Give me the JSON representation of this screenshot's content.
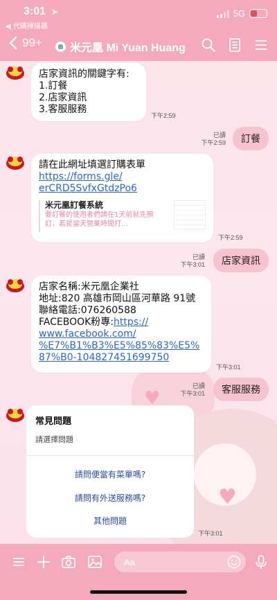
{
  "status": {
    "time": "3:01",
    "back_app": "◀ 代碼掃描器",
    "network": "5G"
  },
  "header": {
    "back_count": "99+",
    "title": "米元凰 Mi Yuan Huang"
  },
  "messages": {
    "m1": {
      "lines": [
        "店家資訊的關鍵字有:",
        "1.訂餐",
        "2.店家資訊",
        "3.客服服務"
      ],
      "time": "下午2:59"
    },
    "o1": {
      "text": "訂餐",
      "read": "已讀",
      "time": "下午2:59"
    },
    "m2": {
      "lead": "請在此網址填選訂購表單",
      "url1": "https://forms.gle/",
      "url2": "erCRD5SvfxGtdzPo6",
      "preview_title": "米元凰訂餐系統",
      "preview_desc": "要訂餐的使用者們請在1天前就先預訂，若是當天營業時間打...",
      "time": "下午2:59"
    },
    "o2": {
      "text": "店家資訊",
      "read": "已讀",
      "time": "下午3:01"
    },
    "m3": {
      "lines": [
        "店家名稱:米元凰企業社",
        "地址:820 高雄市岡山區河華路 91號",
        "聯絡電話:076260588"
      ],
      "fb_label": "FACEBOOK粉專:",
      "fb_url": [
        "https://",
        "www.facebook.com/",
        "%E7%B1%B3%E5%85%83%E5%",
        "87%B0-104827451699750"
      ],
      "time": "下午3:01"
    },
    "o3": {
      "text": "客服服務",
      "read": "已讀",
      "time": "下午3:01"
    },
    "faq": {
      "title": "常見問題",
      "subtitle": "請選擇問題",
      "options": [
        "請問便當有菜單嗎?",
        "請問有外送服務嗎?",
        "其他問題"
      ],
      "time": "下午3:01"
    }
  },
  "input": {
    "placeholder": "Aa"
  },
  "colors": {
    "header": "#f5a9bd",
    "bubble_out": "#f8c3d1",
    "link": "#2a66c9",
    "background": "#fde4ec"
  }
}
